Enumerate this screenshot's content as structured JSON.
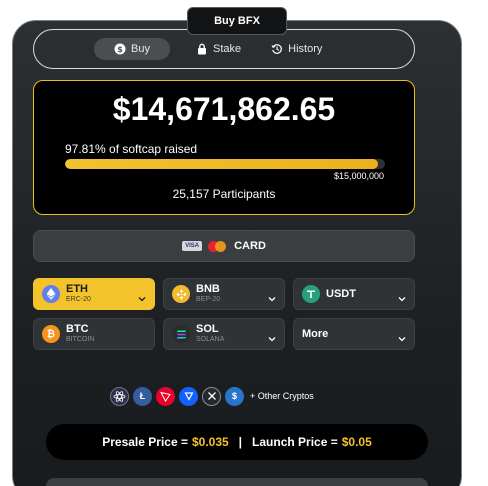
{
  "header": {
    "buy_tab": "Buy BFX"
  },
  "tabs": [
    {
      "label": "Buy",
      "icon": "dollar-coin-icon"
    },
    {
      "label": "Stake",
      "icon": "lock-icon"
    },
    {
      "label": "History",
      "icon": "history-icon"
    }
  ],
  "raise": {
    "amount": "$14,671,862.65",
    "softcap_text": "97.81% of softcap raised",
    "progress_fraction": 0.9781,
    "target": "$15,000,000",
    "participants": "25,157 Participants"
  },
  "card": {
    "label": "CARD",
    "visa": "VISA"
  },
  "coins": [
    {
      "name": "ETH",
      "sub": "ERC-20",
      "icon": "ethereum-icon",
      "color": "#627eea",
      "selected": true
    },
    {
      "name": "BNB",
      "sub": "BEP-20",
      "icon": "bnb-icon",
      "color": "#f3ba2f"
    },
    {
      "name": "USDT",
      "sub": "",
      "icon": "tether-icon",
      "color": "#26a17b"
    },
    {
      "name": "BTC",
      "sub": "BITCOIN",
      "icon": "bitcoin-icon",
      "color": "#f7931a"
    },
    {
      "name": "SOL",
      "sub": "SOLANA",
      "icon": "solana-icon",
      "color": "#2b2b2b"
    },
    {
      "name": "More",
      "sub": "",
      "icon": "",
      "color": ""
    }
  ],
  "other_cryptos": {
    "icons": [
      "cosmos-icon",
      "litecoin-icon",
      "tron-icon",
      "tezos-icon",
      "xrp-icon",
      "usdc-icon"
    ],
    "label": "+ Other Cryptos"
  },
  "price": {
    "presale_label": "Presale Price =",
    "presale_value": "$0.035",
    "separator": "|",
    "launch_label": "Launch Price =",
    "launch_value": "$0.05"
  },
  "colors": {
    "accent": "#f3c32c",
    "panel": "#1d2123"
  }
}
